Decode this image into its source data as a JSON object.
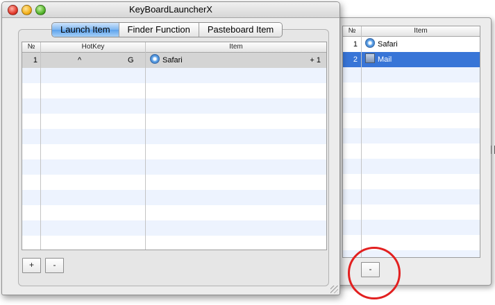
{
  "main_window": {
    "title": "KeyBoardLauncherX",
    "tabs": [
      {
        "label": "Launch Item",
        "active": true
      },
      {
        "label": "Finder Function",
        "active": false
      },
      {
        "label": "Pasteboard Item",
        "active": false
      }
    ],
    "table": {
      "columns": [
        "№",
        "HotKey",
        "Item"
      ],
      "rows": [
        {
          "number": "1",
          "modifier": "^",
          "key": "G",
          "item": "Safari",
          "item_icon": "safari-icon",
          "extra": "+ 1"
        }
      ]
    },
    "buttons": {
      "add_label": "+",
      "remove_label": "-"
    }
  },
  "secondary_window": {
    "table": {
      "columns": [
        "№",
        "Item"
      ],
      "rows": [
        {
          "number": "1",
          "item": "Safari",
          "item_icon": "safari-icon",
          "selected": false
        },
        {
          "number": "2",
          "item": "Mail",
          "item_icon": "mail-icon",
          "selected": true
        }
      ]
    },
    "buttons": {
      "remove_label": "-"
    }
  },
  "colors": {
    "selection": "#3875d7",
    "stripe": "#edf3fe",
    "annotation_circle": "#e22020"
  }
}
